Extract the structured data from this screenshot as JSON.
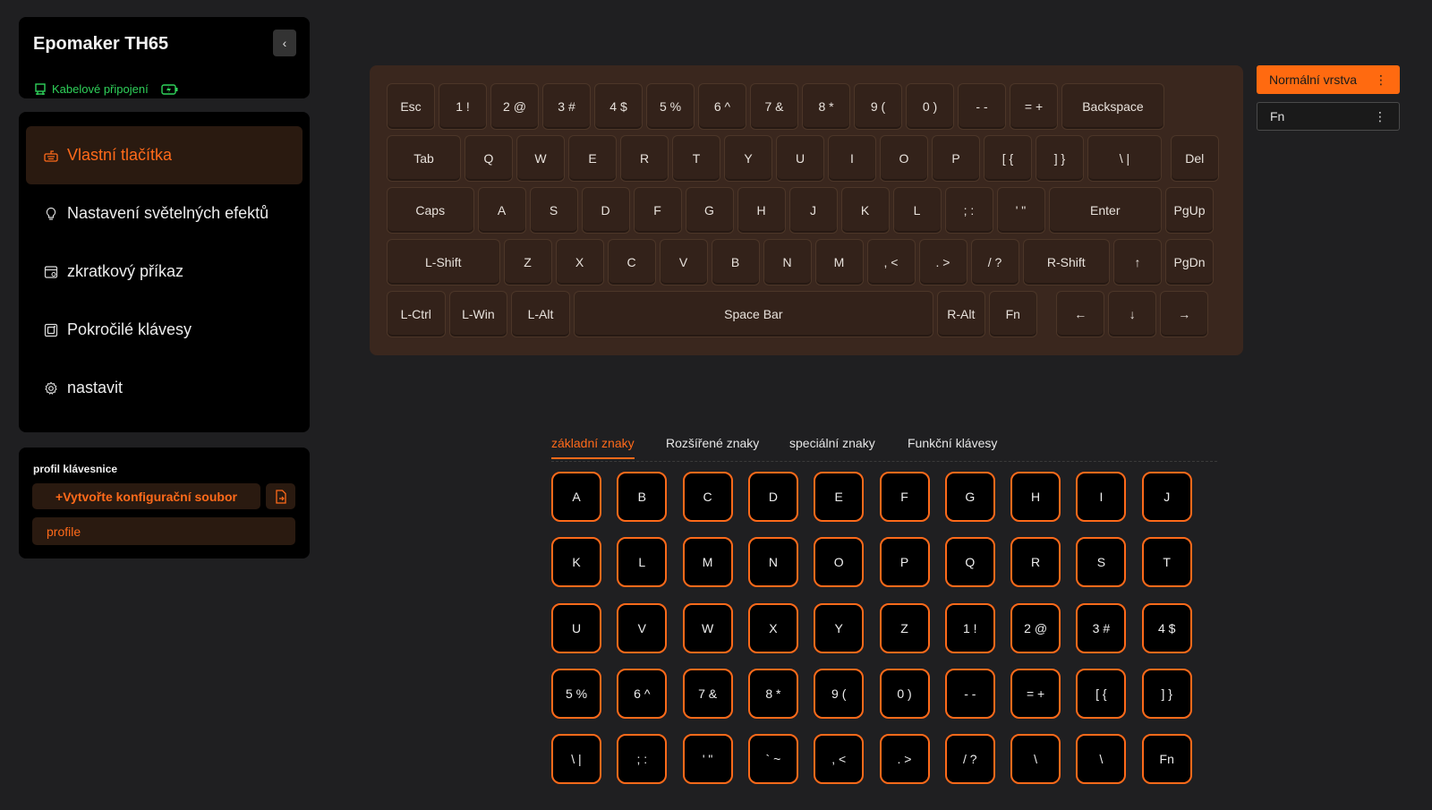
{
  "device": {
    "name": "Epomaker TH65",
    "connection": "Kabelové připojení"
  },
  "nav": {
    "items": [
      {
        "label": "Vlastní tlačítka",
        "icon": "keyboard-icon",
        "active": true
      },
      {
        "label": "Nastavení světelných efektů",
        "icon": "lightbulb-icon",
        "active": false
      },
      {
        "label": "zkratkový příkaz",
        "icon": "macro-icon",
        "active": false
      },
      {
        "label": "Pokročilé klávesy",
        "icon": "advanced-key-icon",
        "active": false
      },
      {
        "label": "nastavit",
        "icon": "gear-icon",
        "active": false
      }
    ]
  },
  "profiles": {
    "heading": "profil klávesnice",
    "create_label": "+Vytvořte konfigurační soubor",
    "items": [
      "profile"
    ]
  },
  "layers": {
    "normal": "Normální vrstva",
    "fn": "Fn"
  },
  "keyboard": {
    "rows": [
      [
        "Esc",
        "1 !",
        "2 @",
        "3 #",
        "4 $",
        "5 %",
        "6 ^",
        "7 &",
        "8 *",
        "9 (",
        "0 )",
        "- -",
        "= +",
        "Backspace"
      ],
      [
        "Tab",
        "Q",
        "W",
        "E",
        "R",
        "T",
        "Y",
        "U",
        "I",
        "O",
        "P",
        "[ {",
        "] }",
        "\\ |",
        "Del"
      ],
      [
        "Caps",
        "A",
        "S",
        "D",
        "F",
        "G",
        "H",
        "J",
        "K",
        "L",
        "; :",
        "' \"",
        "Enter",
        "PgUp"
      ],
      [
        "L-Shift",
        "Z",
        "X",
        "C",
        "V",
        "B",
        "N",
        "M",
        ", <",
        ". >",
        "/ ?",
        "R-Shift",
        "↑",
        "PgDn"
      ],
      [
        "L-Ctrl",
        "L-Win",
        "L-Alt",
        "Space Bar",
        "R-Alt",
        "Fn",
        "←",
        "↓",
        "→"
      ]
    ]
  },
  "tabs": [
    {
      "label": "základní znaky",
      "active": true
    },
    {
      "label": "Rozšířené znaky",
      "active": false
    },
    {
      "label": "speciální znaky",
      "active": false
    },
    {
      "label": "Funkční klávesy",
      "active": false
    }
  ],
  "palette": {
    "keys": [
      "A",
      "B",
      "C",
      "D",
      "E",
      "F",
      "G",
      "H",
      "I",
      "J",
      "K",
      "L",
      "M",
      "N",
      "O",
      "P",
      "Q",
      "R",
      "S",
      "T",
      "U",
      "V",
      "W",
      "X",
      "Y",
      "Z",
      "1 !",
      "2 @",
      "3 #",
      "4 $",
      "5 %",
      "6 ^",
      "7 &",
      "8 *",
      "9 (",
      "0 )",
      "- -",
      "= +",
      "[ {",
      "] }",
      "\\ |",
      "; :",
      "' \"",
      "` ~",
      ", <",
      ". >",
      "/ ?",
      "\\",
      "\\",
      "Fn"
    ]
  },
  "colors": {
    "accent": "#ff6a1a",
    "connection": "#2fd15a",
    "keyboard_plate": "#3a271e"
  }
}
